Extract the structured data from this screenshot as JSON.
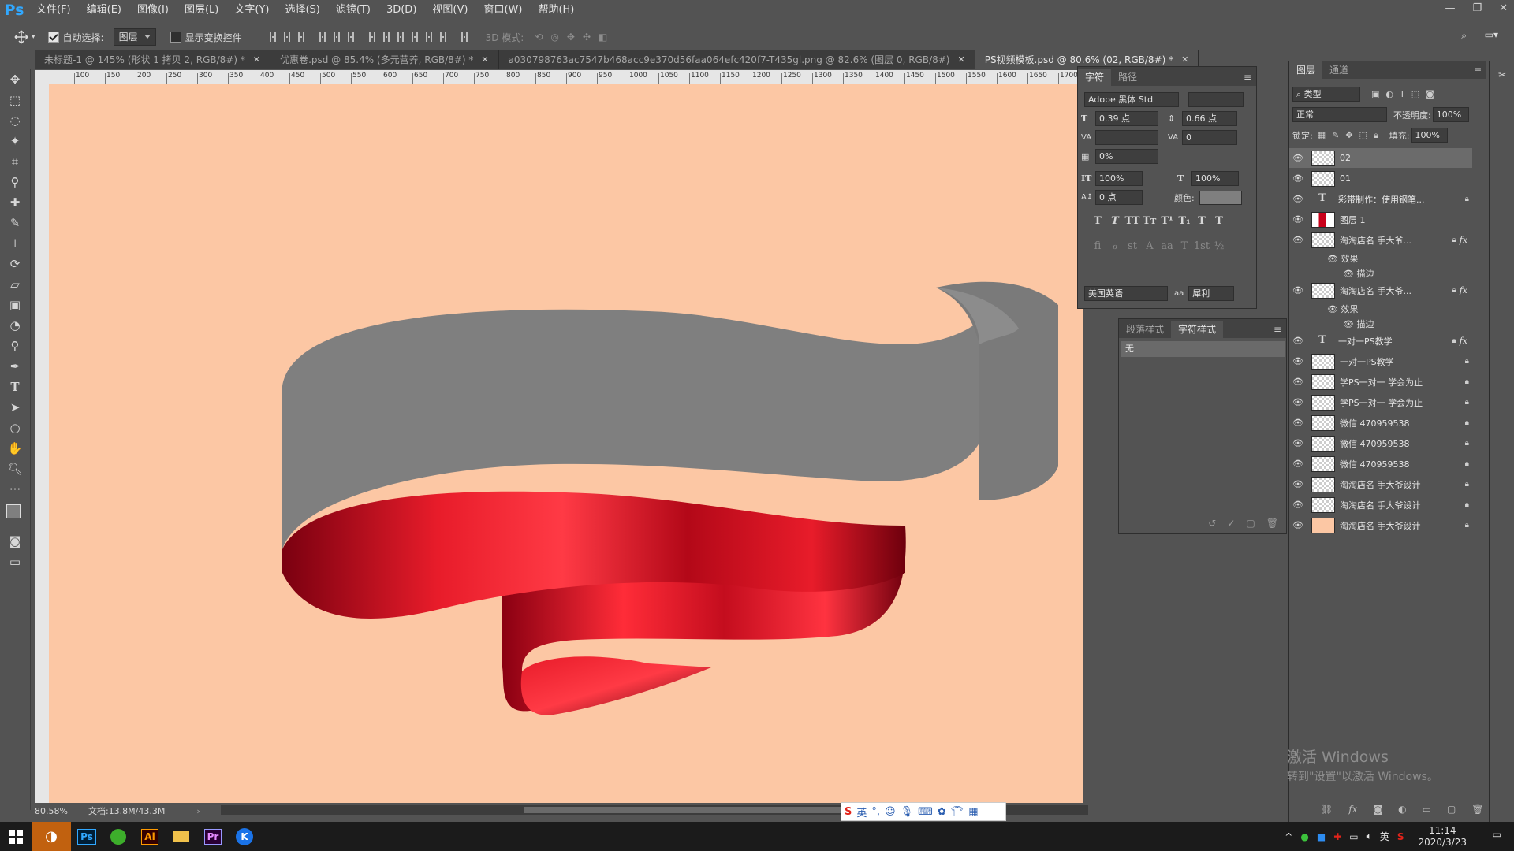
{
  "menubar": {
    "logo": "Ps",
    "items": [
      "文件(F)",
      "编辑(E)",
      "图像(I)",
      "图层(L)",
      "文字(Y)",
      "选择(S)",
      "滤镜(T)",
      "3D(D)",
      "视图(V)",
      "窗口(W)",
      "帮助(H)"
    ]
  },
  "options": {
    "auto_select_label": "自动选择:",
    "auto_select_value": "图层",
    "show_transform_label": "显示变换控件",
    "mode_3d_label": "3D 模式:"
  },
  "tabs": [
    {
      "label": "未标题-1 @ 145% (形状 1 拷贝 2, RGB/8#) *",
      "active": false
    },
    {
      "label": "优惠卷.psd @ 85.4% (多元营养, RGB/8#) *",
      "active": false
    },
    {
      "label": "a030798763ac7547b468acc9e370d56faa064efc420f7-T435gl.png @ 82.6% (图层 0, RGB/8#)",
      "active": false
    },
    {
      "label": "PS视频模板.psd @ 80.6% (02, RGB/8#) *",
      "active": true
    }
  ],
  "ruler": {
    "top_labels": [
      "100",
      "150",
      "200",
      "250",
      "300",
      "350",
      "400",
      "450",
      "500",
      "550",
      "600",
      "650",
      "700",
      "750",
      "800",
      "850",
      "900",
      "950",
      "1000",
      "1050",
      "1100",
      "1150",
      "1200",
      "1250",
      "1300",
      "1350",
      "1400",
      "1450",
      "1500",
      "1550",
      "1600",
      "1650",
      "1700",
      "200"
    ]
  },
  "status": {
    "zoom": "80.58%",
    "doc": "文档:13.8M/43.3M"
  },
  "character_panel": {
    "tabs": [
      "字符",
      "路径"
    ],
    "font": "Adobe 黑体 Std",
    "size": "0.39 点",
    "leading": "0.66 点",
    "tracking": "0",
    "scale_pct": "0%",
    "vscale": "100%",
    "hscale": "100%",
    "baseline": "0 点",
    "color_label": "颜色:",
    "language": "美国英语",
    "aa": "犀利",
    "aa_icon": "aa"
  },
  "style_panel": {
    "tabs": [
      "段落样式",
      "字符样式"
    ],
    "selected": "无"
  },
  "layers_panel": {
    "tabs": [
      "图层",
      "通道"
    ],
    "filter": "类型",
    "blend": "正常",
    "opacity_label": "不透明度:",
    "opacity": "100%",
    "lock_label": "锁定:",
    "fill_label": "填充:",
    "fill": "100%",
    "layers": [
      {
        "name": "02",
        "type": "shape",
        "selected": true
      },
      {
        "name": "01",
        "type": "shape"
      },
      {
        "name": "彩带制作：使用钢笔...",
        "type": "text",
        "lock": true
      },
      {
        "name": "图层 1",
        "type": "image"
      },
      {
        "name": "淘淘店名 手大爷...",
        "type": "shape",
        "lock": true,
        "fx": true
      },
      {
        "name": "效果",
        "type": "effect"
      },
      {
        "name": "描边",
        "type": "effect-item"
      },
      {
        "name": "淘淘店名 手大爷...",
        "type": "shape",
        "lock": true,
        "fx": true
      },
      {
        "name": "效果",
        "type": "effect"
      },
      {
        "name": "描边",
        "type": "effect-item"
      },
      {
        "name": "一对一PS教学",
        "type": "text",
        "lock": true,
        "fx": true
      },
      {
        "name": "一对一PS教学",
        "type": "shape",
        "lock": true
      },
      {
        "name": "学PS一对一 学会为止",
        "type": "shape",
        "lock": true
      },
      {
        "name": "学PS一对一 学会为止",
        "type": "shape",
        "lock": true
      },
      {
        "name": "微信 470959538",
        "type": "shape",
        "lock": true
      },
      {
        "name": "微信 470959538",
        "type": "shape",
        "lock": true
      },
      {
        "name": "微信 470959538",
        "type": "shape",
        "lock": true
      },
      {
        "name": "淘淘店名 手大爷设计",
        "type": "shape",
        "lock": true
      },
      {
        "name": "淘淘店名 手大爷设计",
        "type": "shape",
        "lock": true
      },
      {
        "name": "淘淘店名 手大爷设计",
        "type": "peach",
        "lock": true
      }
    ]
  },
  "windows_activation": {
    "title": "激活 Windows",
    "subtitle": "转到\"设置\"以激活 Windows。"
  },
  "ime": {
    "lang": "英"
  },
  "taskbar": {
    "time": "11:14",
    "date": "2020/3/23",
    "ime_lang": "英"
  },
  "colors": {
    "canvas_bg": "#fcc7a4",
    "ribbon_gray": "#7f7f7f",
    "ribbon_red": "#e81c2a"
  }
}
